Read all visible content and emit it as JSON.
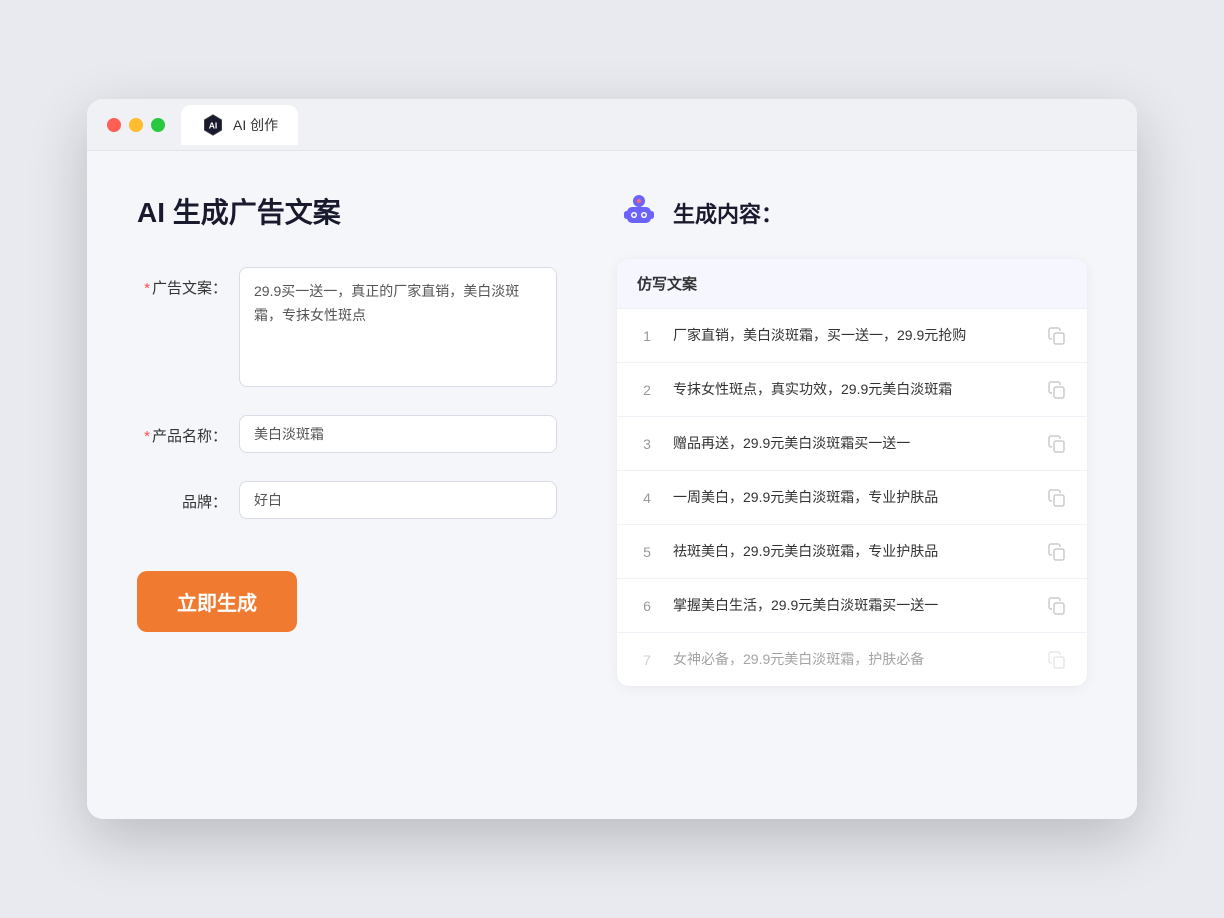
{
  "browser": {
    "tab_title": "AI 创作"
  },
  "page": {
    "title": "AI 生成广告文案"
  },
  "form": {
    "ad_copy_label": "广告文案：",
    "ad_copy_required": "*",
    "ad_copy_value": "29.9买一送一，真正的厂家直销，美白淡斑霜，专抹女性斑点",
    "product_label": "产品名称：",
    "product_required": "*",
    "product_value": "美白淡斑霜",
    "brand_label": "品牌：",
    "brand_value": "好白",
    "generate_button": "立即生成"
  },
  "result": {
    "title": "生成内容：",
    "table_header": "仿写文案",
    "items": [
      {
        "num": "1",
        "text": "厂家直销，美白淡斑霜，买一送一，29.9元抢购",
        "dimmed": false
      },
      {
        "num": "2",
        "text": "专抹女性斑点，真实功效，29.9元美白淡斑霜",
        "dimmed": false
      },
      {
        "num": "3",
        "text": "赠品再送，29.9元美白淡斑霜买一送一",
        "dimmed": false
      },
      {
        "num": "4",
        "text": "一周美白，29.9元美白淡斑霜，专业护肤品",
        "dimmed": false
      },
      {
        "num": "5",
        "text": "祛斑美白，29.9元美白淡斑霜，专业护肤品",
        "dimmed": false
      },
      {
        "num": "6",
        "text": "掌握美白生活，29.9元美白淡斑霜买一送一",
        "dimmed": false
      },
      {
        "num": "7",
        "text": "女神必备，29.9元美白淡斑霜，护肤必备",
        "dimmed": true
      }
    ]
  }
}
